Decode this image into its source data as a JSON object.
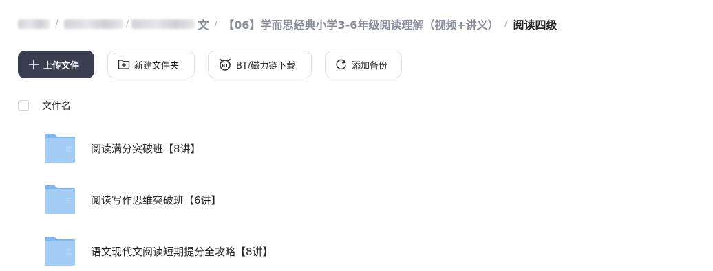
{
  "breadcrumb": {
    "visible_tail": "文",
    "parent": "【06】学而思经典小学3-6年级阅读理解（视频+讲义）",
    "current": "阅读四级",
    "separator": "/"
  },
  "toolbar": {
    "upload": {
      "label": "上传文件",
      "icon": "plus-icon"
    },
    "new_folder": {
      "label": "新建文件夹",
      "icon": "folder-plus-icon"
    },
    "bt_download": {
      "label": "BT/磁力链下载",
      "icon": "bt-icon"
    },
    "add_backup": {
      "label": "添加备份",
      "icon": "sync-icon"
    }
  },
  "list": {
    "header": {
      "name_column": "文件名"
    },
    "items": [
      {
        "name": "阅读满分突破班【8讲】",
        "type": "folder"
      },
      {
        "name": "阅读写作思维突破班【6讲】",
        "type": "folder"
      },
      {
        "name": "语文现代文阅读短期提分全攻略【8讲】",
        "type": "folder"
      }
    ]
  },
  "colors": {
    "primary_button": "#3b3e51",
    "text_primary": "#25262b",
    "text_secondary": "#878c9c",
    "folder_blue": "#8cc2f5"
  }
}
